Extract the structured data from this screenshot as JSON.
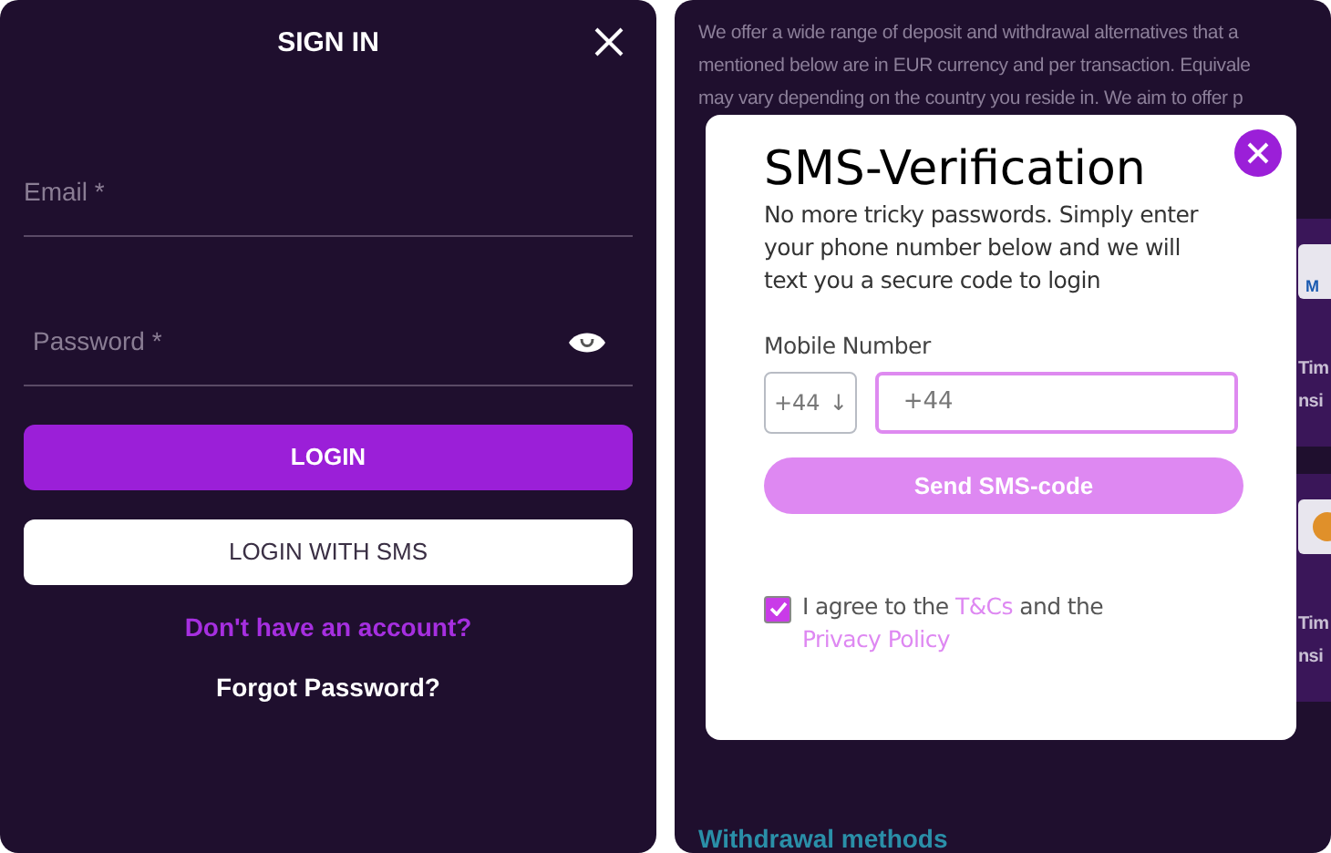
{
  "sign_in": {
    "title": "SIGN IN",
    "fields": [
      {
        "placeholder": "Email *",
        "kind": "text"
      },
      {
        "placeholder": "Password *",
        "kind": "password"
      }
    ],
    "login_button": "LOGIN",
    "sms_button": "LOGIN WITH SMS",
    "register_link": "Don't have an account?",
    "forgot_link": "Forgot Password?"
  },
  "background": {
    "paragraph_lines": [
      "We offer a wide range of deposit and withdrawal alternatives that a",
      "mentioned below are in EUR currency and per transaction. Equivale",
      "may vary depending on the country you reside in. We aim to offer p"
    ],
    "cards": [
      {
        "logo": "M",
        "kind": "card-logo",
        "lines": [
          "Tim",
          "nsi"
        ]
      },
      {
        "kind": "coin-logo",
        "lines": [
          "Tim",
          "nsi"
        ]
      }
    ],
    "heading": "Withdrawal methods"
  },
  "sms_modal": {
    "title": "SMS-Verification",
    "description": "No more tricky passwords. Simply enter your phone number below and we will text you a secure code to login",
    "field_label": "Mobile Number",
    "country_code": "+44",
    "arrow": "↓",
    "phone_value": "+44",
    "send_button": "Send SMS-code",
    "agree": {
      "checked": true,
      "before": "I agree to the",
      "link1": "T&Cs",
      "middle": "and the",
      "link2": "Privacy Policy"
    }
  }
}
